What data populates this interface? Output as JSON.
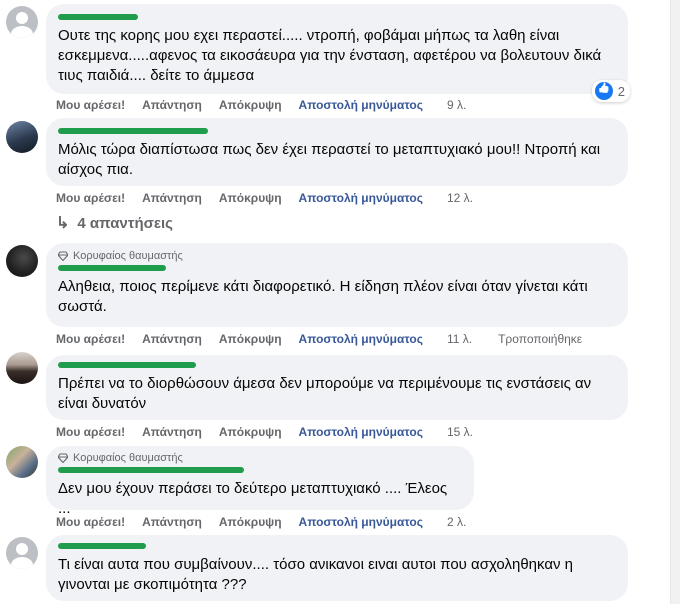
{
  "actions": {
    "like": "Μου αρέσει!",
    "reply": "Απάντηση",
    "hide": "Απόκρυψη",
    "message": "Αποστολή μηνύματος"
  },
  "comments": [
    {
      "text": "Ουτε της κορης μου εχει περαστεί..... ντροπή, φοβάμαι μήπως τα λαθη είναι εσκεμμενα.....αφενος τα εικοσάευρα για την ένσταση, αφετέρου να βολευτουν δικά τιυς παιδιά.... δείτε το άμμεσα",
      "time": "9 λ.",
      "reactions": "2"
    },
    {
      "text": "Μόλις τώρα διαπίστωσα πως δεν έχει περαστεί το μεταπτυχιακό μου!! Ντροπή και αίσχος πια.",
      "time": "12 λ.",
      "replies": "4 απαντήσεις"
    },
    {
      "badge": "Κορυφαίος θαυμαστής",
      "text": "Αληθεια, ποιος περίμενε κάτι διαφορετικό. Η είδηση πλέον είναι όταν γίνεται κάτι σωστά.",
      "time": "11 λ.",
      "edited": "Τροποποιήθηκε"
    },
    {
      "text": "Πρέπει να το διορθώσουν άμεσα δεν μπορούμε να περιμένουμε τις ενστάσεις αν είναι δυνατόν",
      "time": "15 λ."
    },
    {
      "badge": "Κορυφαίος θαυμαστής",
      "text": "Δεν μου έχουν περάσει το δεύτερο μεταπτυχιακό .... Έλεος ...",
      "time": "2 λ."
    },
    {
      "text": "Τι είναι αυτα που συμβαίνουν.... τόσο ανικανοι ειναι αυτοι που ασχοληθηκαν η γινονται με σκοπιμότητα ???"
    }
  ]
}
